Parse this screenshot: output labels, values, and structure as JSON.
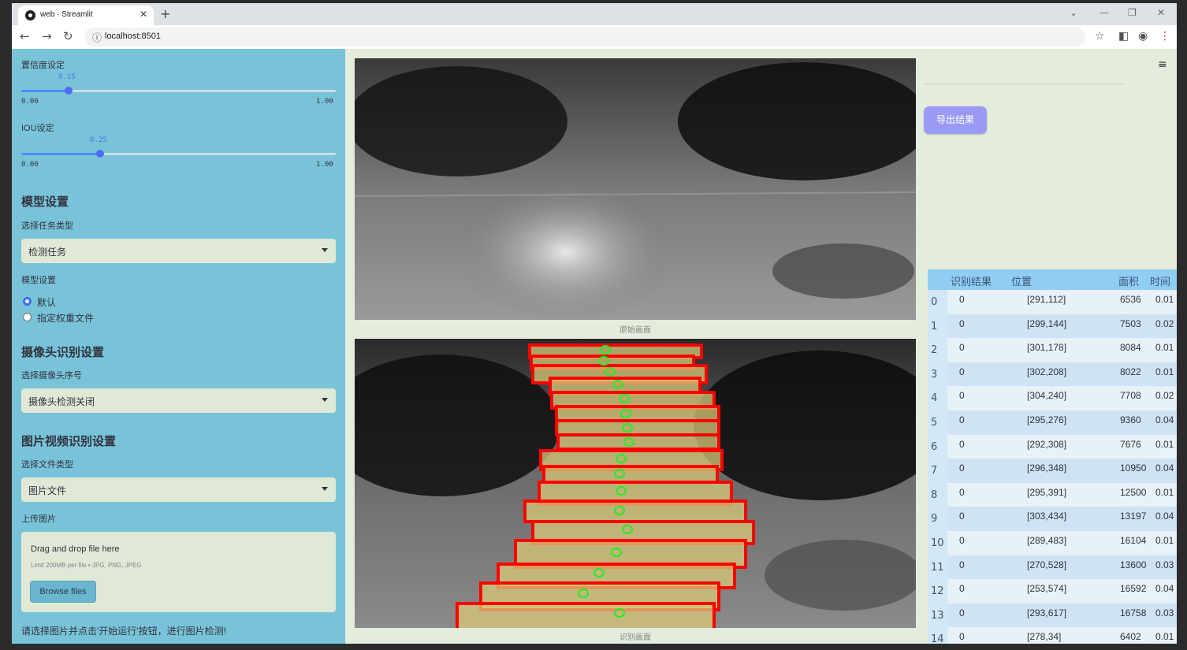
{
  "browser": {
    "tab_title": "web · Streamlit",
    "url": "localhost:8501"
  },
  "sidebar": {
    "confidence": {
      "label": "置信度设定",
      "value": "0.15",
      "min": "0.00",
      "max": "1.00",
      "fraction": 0.15
    },
    "iou": {
      "label": "IOU设定",
      "value": "0.25",
      "min": "0.00",
      "max": "1.00",
      "fraction": 0.25
    },
    "model_header": "模型设置",
    "task_label": "选择任务类型",
    "task_value": "检测任务",
    "model_label": "模型设置",
    "model_options": [
      "默认",
      "指定权重文件"
    ],
    "camera_header": "摄像头识别设置",
    "camera_label": "选择摄像头序号",
    "camera_value": "摄像头检测关闭",
    "media_header": "图片视频识别设置",
    "file_type_label": "选择文件类型",
    "file_type_value": "图片文件",
    "upload_label": "上传图片",
    "upload_drop": "Drag and drop file here",
    "upload_limit": "Limit 200MB per file • JPG, PNG, JPEG",
    "browse_label": "Browse files",
    "hint": "请选择图片并点击'开始运行'按钮，进行图片检测!"
  },
  "main": {
    "original_caption": "原始画面",
    "result_caption": "识别画面",
    "export_label": "导出结果"
  },
  "table": {
    "headers": [
      "识别结果",
      "位置",
      "面积",
      "时间"
    ],
    "rows": [
      {
        "i": "0",
        "result": "0",
        "pos": "[291,112]",
        "area": "6536",
        "time": "0.01"
      },
      {
        "i": "1",
        "result": "0",
        "pos": "[299,144]",
        "area": "7503",
        "time": "0.02"
      },
      {
        "i": "2",
        "result": "0",
        "pos": "[301,178]",
        "area": "8084",
        "time": "0.01"
      },
      {
        "i": "3",
        "result": "0",
        "pos": "[302,208]",
        "area": "8022",
        "time": "0.01"
      },
      {
        "i": "4",
        "result": "0",
        "pos": "[304,240]",
        "area": "7708",
        "time": "0.02"
      },
      {
        "i": "5",
        "result": "0",
        "pos": "[295,276]",
        "area": "9360",
        "time": "0.04"
      },
      {
        "i": "6",
        "result": "0",
        "pos": "[292,308]",
        "area": "7676",
        "time": "0.01"
      },
      {
        "i": "7",
        "result": "0",
        "pos": "[296,348]",
        "area": "10950",
        "time": "0.04"
      },
      {
        "i": "8",
        "result": "0",
        "pos": "[295,391]",
        "area": "12500",
        "time": "0.01"
      },
      {
        "i": "9",
        "result": "0",
        "pos": "[303,434]",
        "area": "13197",
        "time": "0.04"
      },
      {
        "i": "10",
        "result": "0",
        "pos": "[289,483]",
        "area": "16104",
        "time": "0.01"
      },
      {
        "i": "11",
        "result": "0",
        "pos": "[270,528]",
        "area": "13600",
        "time": "0.03"
      },
      {
        "i": "12",
        "result": "0",
        "pos": "[253,574]",
        "area": "16592",
        "time": "0.04"
      },
      {
        "i": "13",
        "result": "0",
        "pos": "[293,617]",
        "area": "16758",
        "time": "0.03"
      },
      {
        "i": "14",
        "result": "0",
        "pos": "[278,34]",
        "area": "6402",
        "time": "0.01"
      }
    ]
  },
  "colors": {
    "sidebar": "#79c3d9",
    "main_bg": "#e4ecdc",
    "accent": "#4c6ef5",
    "box": "#ff0000",
    "center": "#22ee22"
  }
}
